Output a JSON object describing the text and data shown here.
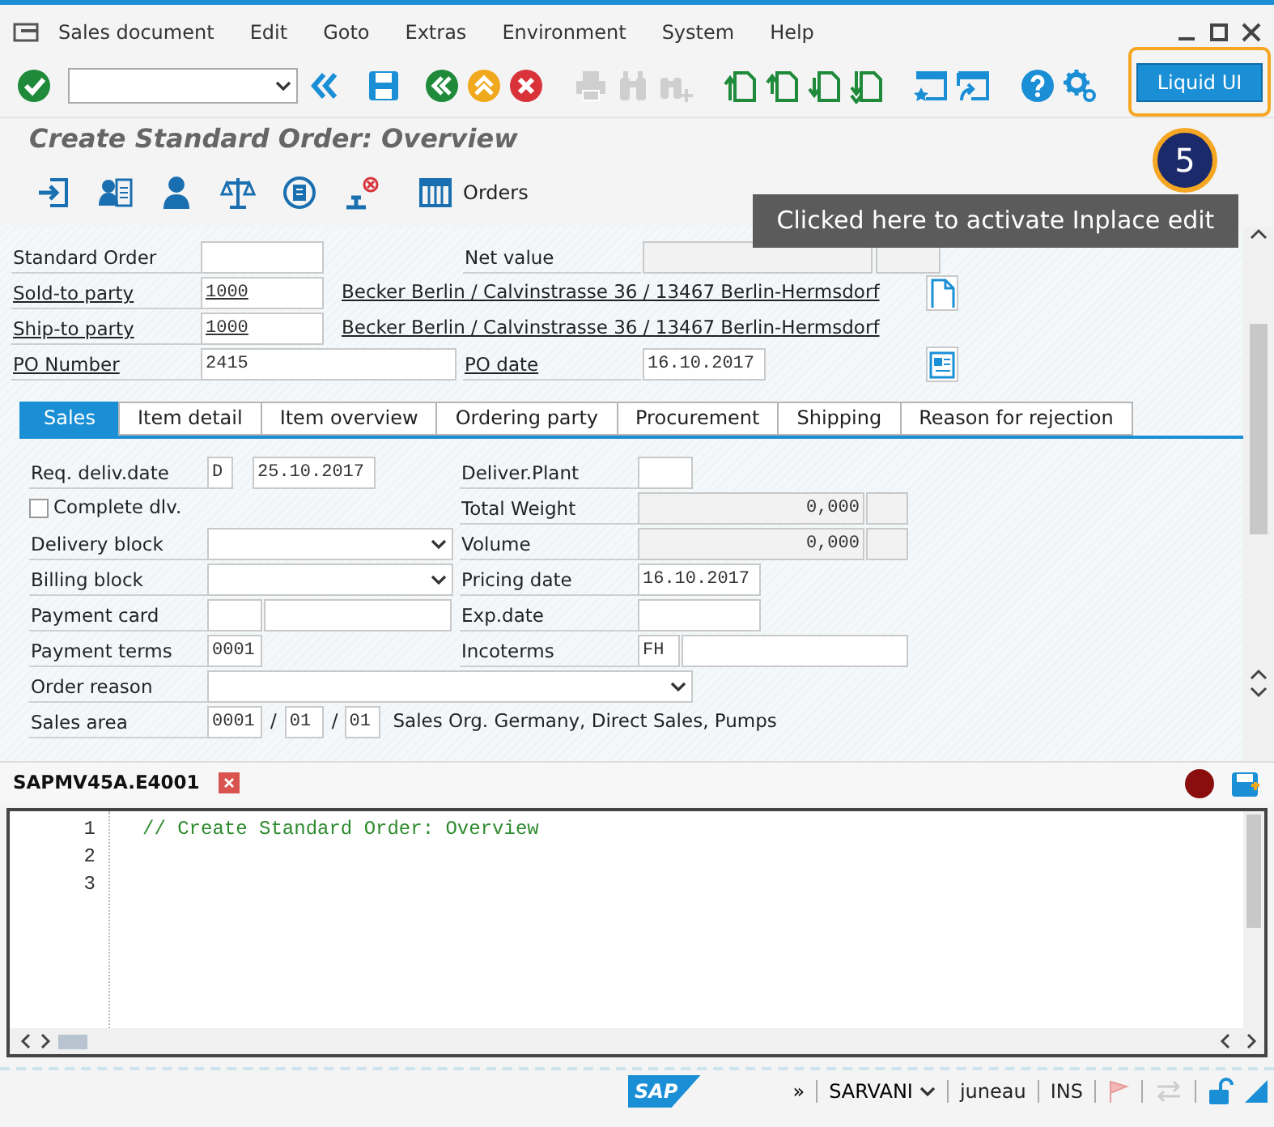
{
  "menu": [
    "Sales document",
    "Edit",
    "Goto",
    "Extras",
    "Environment",
    "System",
    "Help"
  ],
  "toolbar": [
    {
      "kind": "enter",
      "disabled": false
    },
    {
      "kind": "command"
    },
    {
      "kind": "collapse",
      "disabled": false
    },
    {
      "kind": "save",
      "disabled": false
    },
    {
      "kind": "back",
      "disabled": false
    },
    {
      "kind": "exit",
      "disabled": false
    },
    {
      "kind": "cancel",
      "disabled": false
    },
    {
      "kind": "print",
      "disabled": true
    },
    {
      "kind": "find",
      "disabled": true
    },
    {
      "kind": "find-next",
      "disabled": true
    },
    {
      "kind": "first-page",
      "disabled": false
    },
    {
      "kind": "previous-page",
      "disabled": false
    },
    {
      "kind": "next-page",
      "disabled": false
    },
    {
      "kind": "last-page",
      "disabled": false
    },
    {
      "kind": "new-session",
      "disabled": false
    },
    {
      "kind": "shortcut",
      "disabled": false
    },
    {
      "kind": "help",
      "disabled": false
    },
    {
      "kind": "customize",
      "disabled": false
    }
  ],
  "liquid_ui_button": {
    "label": "Liquid UI",
    "highlighted": true
  },
  "callout": {
    "step": "5",
    "text": "Clicked here to activate Inplace edit"
  },
  "title": "Create Standard Order: Overview",
  "app_toolbar": [
    {
      "kind": "display"
    },
    {
      "kind": "partner"
    },
    {
      "kind": "person"
    },
    {
      "kind": "scales"
    },
    {
      "kind": "document"
    },
    {
      "kind": "stamp"
    },
    {
      "kind": "orders",
      "label": "Orders"
    }
  ],
  "header": [
    [
      {
        "kind": "label",
        "text": "Standard Order"
      },
      {
        "kind": "input"
      },
      {
        "kind": "label",
        "text": "Net value"
      },
      {
        "kind": "display"
      },
      {
        "kind": "display"
      }
    ],
    [
      {
        "kind": "link-label",
        "text": "Sold-to party"
      },
      {
        "kind": "input",
        "value": "1000",
        "underlined": true
      },
      {
        "kind": "link-text",
        "text": "Becker Berlin / Calvinstrasse 36 / 13467 Berlin-Hermsdorf"
      },
      {
        "kind": "page-button"
      }
    ],
    [
      {
        "kind": "link-label",
        "text": "Ship-to party"
      },
      {
        "kind": "input",
        "value": "1000",
        "underlined": true
      },
      {
        "kind": "link-text",
        "text": "Becker Berlin / Calvinstrasse 36 / 13467 Berlin-Hermsdorf"
      }
    ],
    [
      {
        "kind": "link-label",
        "text": "PO Number"
      },
      {
        "kind": "input",
        "value": "2415",
        "underlined": false
      },
      {
        "kind": "link-label",
        "text": "PO date"
      },
      {
        "kind": "input",
        "value": "16.10.2017",
        "underlined": false
      },
      {
        "kind": "form-button"
      }
    ]
  ],
  "tabs": [
    {
      "label": "Sales",
      "selected": true
    },
    {
      "label": "Item detail",
      "selected": false
    },
    {
      "label": "Item overview",
      "selected": false
    },
    {
      "label": "Ordering party",
      "selected": false
    },
    {
      "label": "Procurement",
      "selected": false
    },
    {
      "label": "Shipping",
      "selected": false
    },
    {
      "label": "Reason for rejection",
      "selected": false
    }
  ],
  "sales_tab": [
    [
      {
        "kind": "label",
        "text": "Req. deliv.date"
      },
      {
        "kind": "input",
        "value": "D"
      },
      {
        "kind": "input",
        "value": "25.10.2017"
      },
      {
        "kind": "label",
        "text": "Deliver.Plant"
      },
      {
        "kind": "input"
      }
    ],
    [
      {
        "kind": "checkbox",
        "text": "Complete dlv.",
        "checked": false
      },
      {
        "kind": "label",
        "text": "Total Weight"
      },
      {
        "kind": "display",
        "value": "0,000"
      },
      {
        "kind": "display"
      }
    ],
    [
      {
        "kind": "label",
        "text": "Delivery block"
      },
      {
        "kind": "select"
      },
      {
        "kind": "label",
        "text": "Volume"
      },
      {
        "kind": "display",
        "value": "0,000"
      },
      {
        "kind": "display"
      }
    ],
    [
      {
        "kind": "label",
        "text": "Billing block"
      },
      {
        "kind": "select"
      },
      {
        "kind": "label",
        "text": "Pricing date"
      },
      {
        "kind": "input",
        "value": "16.10.2017"
      }
    ],
    [
      {
        "kind": "label",
        "text": "Payment card"
      },
      {
        "kind": "input"
      },
      {
        "kind": "input"
      },
      {
        "kind": "label",
        "text": "Exp.date"
      },
      {
        "kind": "input"
      }
    ],
    [
      {
        "kind": "label",
        "text": "Payment terms"
      },
      {
        "kind": "input",
        "value": "0001"
      },
      {
        "kind": "label",
        "text": "Incoterms"
      },
      {
        "kind": "input",
        "value": "FH"
      },
      {
        "kind": "input"
      }
    ],
    [
      {
        "kind": "label",
        "text": "Order reason"
      },
      {
        "kind": "select"
      }
    ],
    [
      {
        "kind": "label",
        "text": "Sales area"
      },
      {
        "kind": "input",
        "value": "0001"
      },
      {
        "kind": "text",
        "text": "/"
      },
      {
        "kind": "input",
        "value": "01"
      },
      {
        "kind": "text",
        "text": "/"
      },
      {
        "kind": "input",
        "value": "01"
      },
      {
        "kind": "text",
        "text": "Sales Org. Germany, Direct Sales, Pumps"
      }
    ]
  ],
  "editor": {
    "tab": "SAPMV45A.E4001",
    "lines": [
      {
        "number": "1",
        "code": "// Create Standard Order: Overview"
      },
      {
        "number": "2"
      },
      {
        "number": "3"
      }
    ]
  },
  "status_bar": {
    "logo": "SAP",
    "items": [
      {
        "kind": "expand",
        "text": "»"
      },
      {
        "kind": "system",
        "text": "SARVANI"
      },
      {
        "kind": "client",
        "text": "juneau"
      },
      {
        "kind": "mode",
        "text": "INS"
      }
    ]
  }
}
